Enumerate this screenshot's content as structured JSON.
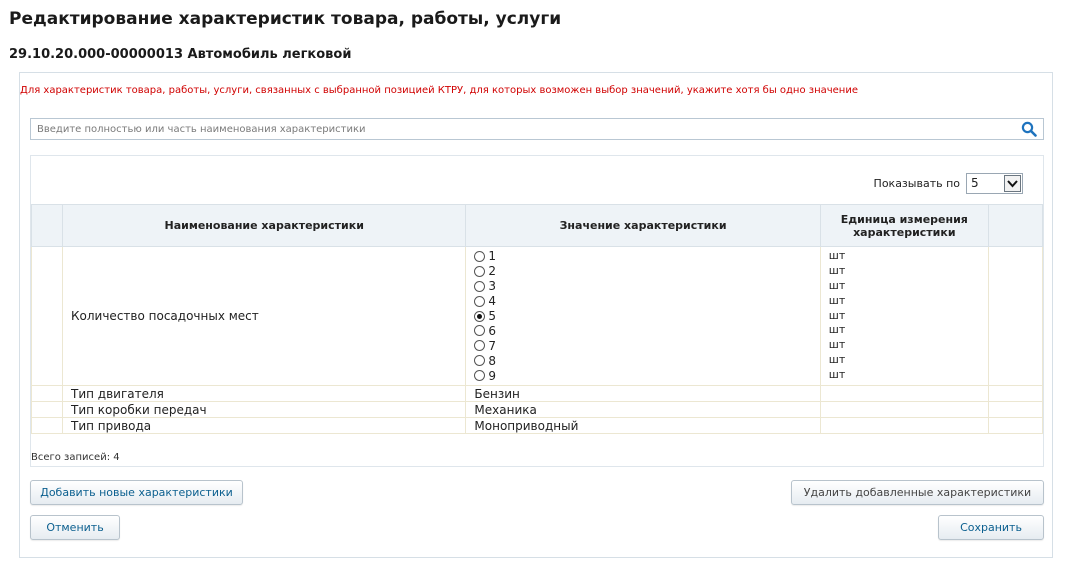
{
  "page": {
    "title": "Редактирование характеристик товара, работы, услуги",
    "product": "29.10.20.000-00000013 Автомобиль легковой"
  },
  "warning": "Для характеристик товара, работы, услуги, связанных с выбранной позицией КТРУ, для которых возможен выбор значений, укажите хотя бы одно значение",
  "search": {
    "placeholder": "Введите полностью или часть наименования характеристики"
  },
  "paging": {
    "label": "Показывать по",
    "value": "5"
  },
  "table": {
    "columns": [
      "Наименование характеристики",
      "Значение характеристики",
      "Единица измерения характеристики"
    ],
    "rows": [
      {
        "name": "Количество посадочных мест",
        "options": [
          "1",
          "2",
          "3",
          "4",
          "5",
          "6",
          "7",
          "8",
          "9"
        ],
        "selected": "5",
        "units": [
          "шт",
          "шт",
          "шт",
          "шт",
          "шт",
          "шт",
          "шт",
          "шт",
          "шт"
        ]
      },
      {
        "name": "Тип двигателя",
        "value": "Бензин",
        "unit": ""
      },
      {
        "name": "Тип коробки передач",
        "value": "Механика",
        "unit": ""
      },
      {
        "name": "Тип привода",
        "value": "Моноприводный",
        "unit": ""
      }
    ]
  },
  "total": "Всего записей: 4",
  "buttons": {
    "add": "Добавить новые характеристики",
    "delete": "Удалить добавленные характеристики",
    "cancel": "Отменить",
    "save": "Сохранить"
  },
  "colors": {
    "warning": "#d00000",
    "link_button": "#0b5f8f",
    "search_icon": "#1e73be"
  }
}
